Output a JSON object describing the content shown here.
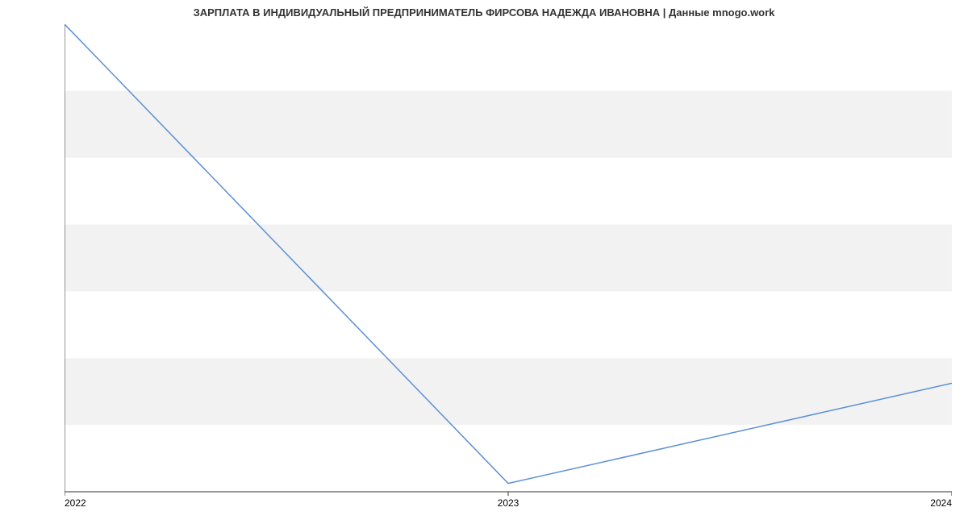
{
  "chart_data": {
    "type": "line",
    "title": "ЗАРПЛАТА В ИНДИВИДУАЛЬНЫЙ ПРЕДПРИНИМАТЕЛЬ ФИРСОВА НАДЕЖДА ИВАНОВНА | Данные mnogo.work",
    "xlabel": "",
    "ylabel": "",
    "x": [
      2022,
      2023,
      2024
    ],
    "values": [
      30000,
      16250,
      19250
    ],
    "x_ticks": [
      2022,
      2023,
      2024
    ],
    "y_ticks": [
      16000,
      18000,
      20000,
      22000,
      24000,
      26000,
      28000,
      30000
    ],
    "xlim": [
      2022,
      2024
    ],
    "ylim": [
      16000,
      30000
    ],
    "line_color": "#5b8fd6",
    "band_color": "#f2f2f2"
  }
}
